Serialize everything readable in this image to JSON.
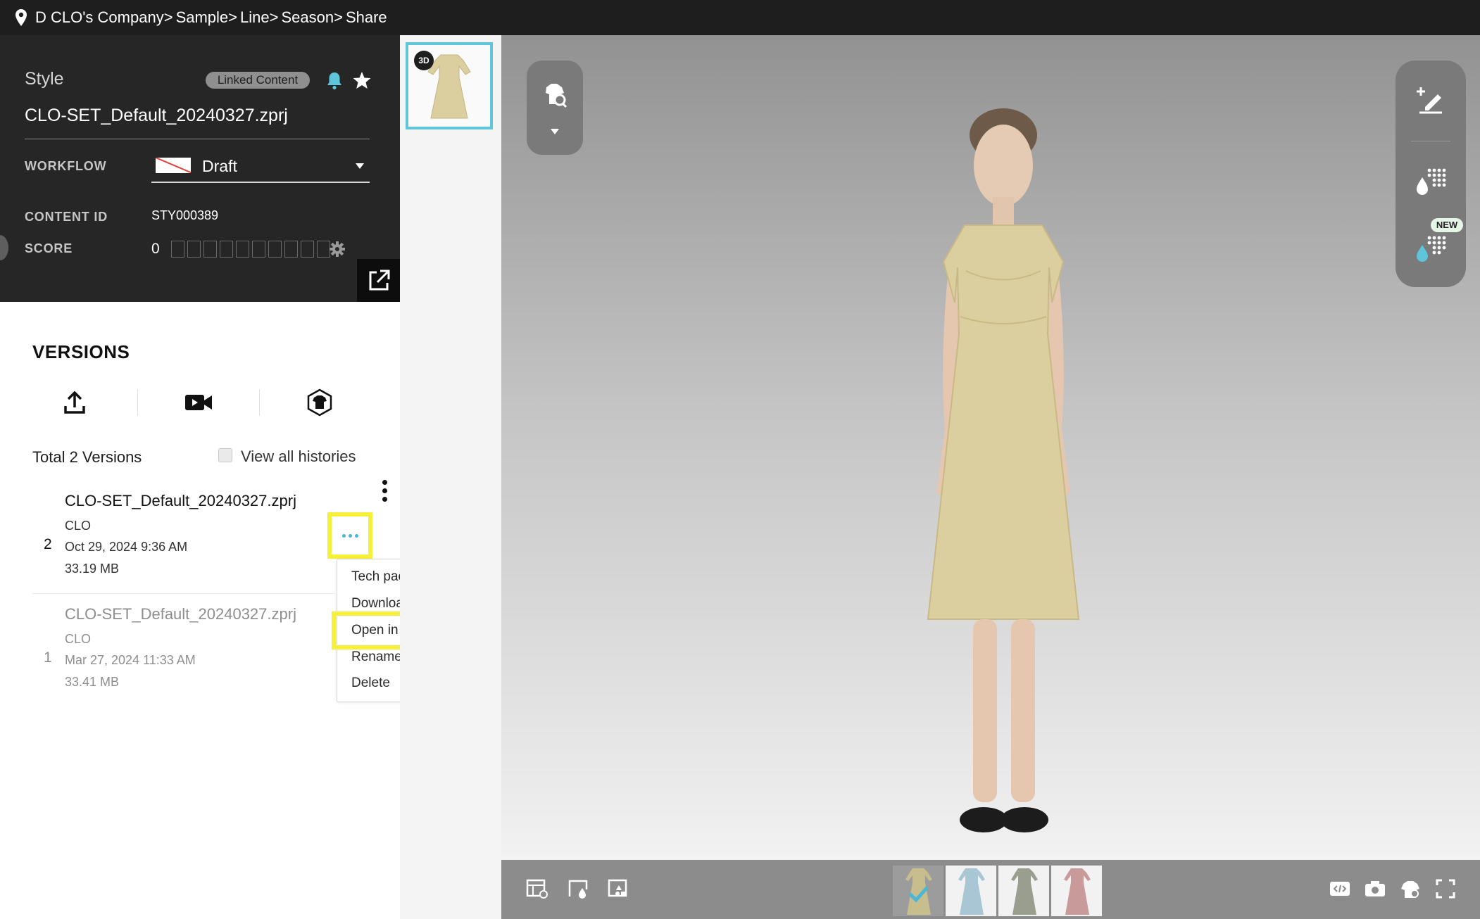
{
  "breadcrumb": {
    "items": [
      "D CLO's Company",
      "Sample",
      "Line",
      "Season",
      "Share"
    ],
    "separator": ">"
  },
  "style_panel": {
    "label": "Style",
    "linked_badge": "Linked Content",
    "file_title": "CLO-SET_Default_20240327.zprj",
    "workflow_label": "WORKFLOW",
    "workflow_value": "Draft",
    "content_id_label": "CONTENT ID",
    "content_id_value": "STY000389",
    "score_label": "SCORE",
    "score_value": "0",
    "score_max_boxes": 10
  },
  "versions": {
    "title": "VERSIONS",
    "total_label": "Total 2 Versions",
    "view_all_label": "View all histories",
    "view_all_checked": false,
    "items": [
      {
        "number": "2",
        "name": "CLO-SET_Default_20240327.zprj",
        "source": "CLO",
        "date": "Oct 29, 2024 9:36 AM",
        "size": "33.19 MB"
      },
      {
        "number": "1",
        "name": "CLO-SET_Default_20240327.zprj",
        "source": "CLO",
        "date": "Mar 27, 2024 11:33 AM",
        "size": "33.41 MB"
      }
    ]
  },
  "context_menu": {
    "items": [
      "Tech pack",
      "Download...",
      "Open in CLO",
      "Rename",
      "Delete"
    ],
    "highlighted": "Open in CLO"
  },
  "viewer": {
    "thumbnail_badge": "3D",
    "new_badge": "NEW",
    "colorways": [
      "#c8bd8d",
      "#a8c6d4",
      "#9a9e8e",
      "#c99a9a"
    ],
    "selected_colorway": 0
  },
  "colors": {
    "topbar": "#1e1e1e",
    "accent_cyan": "#5ec5da",
    "highlight_yellow": "#f7f03a",
    "dress": "#dccf9f"
  }
}
